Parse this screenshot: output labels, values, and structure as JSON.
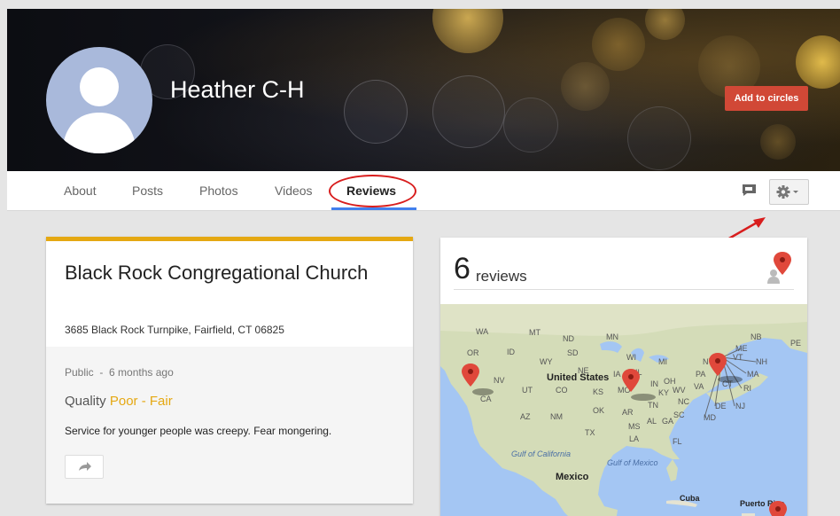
{
  "profile": {
    "name": "Heather C-H",
    "add_button": "Add to circles"
  },
  "tabs": [
    {
      "label": "About"
    },
    {
      "label": "Posts"
    },
    {
      "label": "Photos"
    },
    {
      "label": "Videos"
    },
    {
      "label": "Reviews",
      "active": true
    }
  ],
  "review": {
    "place_name": "Black Rock Congregational Church",
    "address": "3685 Black Rock Turnpike, Fairfield, CT 06825",
    "visibility": "Public",
    "separator": "-",
    "age": "6 months ago",
    "quality_label": "Quality",
    "quality_rating": "Poor - Fair",
    "text": "Service for younger people was creepy. Fear mongering."
  },
  "reviews_summary": {
    "count": "6",
    "label": "reviews"
  },
  "map": {
    "country_label": "United States",
    "labels": [
      "WA",
      "MT",
      "ND",
      "MN",
      "ME",
      "NB",
      "PE",
      "OR",
      "ID",
      "SD",
      "WI",
      "MI",
      "NY",
      "VT",
      "NH",
      "NV",
      "WY",
      "NE",
      "IA",
      "OH",
      "PA",
      "MA",
      "CT",
      "RI",
      "NJ",
      "DE",
      "MD",
      "UT",
      "CO",
      "KS",
      "MO",
      "IL",
      "IN",
      "WV",
      "VA",
      "CA",
      "AZ",
      "NM",
      "OK",
      "AR",
      "TN",
      "KY",
      "NC",
      "SC",
      "MS",
      "AL",
      "GA",
      "TX",
      "LA",
      "FL",
      "Mexico",
      "Gulf of California",
      "Gulf of Mexico",
      "Cuba",
      "Puerto Rico"
    ]
  },
  "colors": {
    "accent_red": "#d14836",
    "tab_underline": "#427fed",
    "card_top_border": "#e5a812",
    "annotation_red": "#d81d1d"
  },
  "icons": [
    "default-avatar-icon",
    "chat-icon",
    "gear-icon",
    "share-icon",
    "map-pin-icon"
  ]
}
